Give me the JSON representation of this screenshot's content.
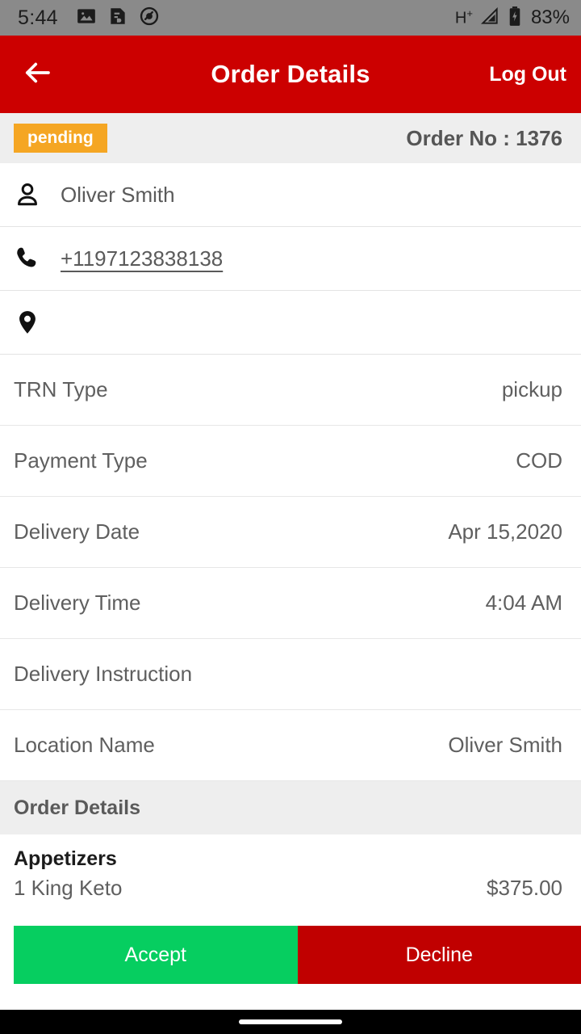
{
  "status_bar": {
    "time": "5:44",
    "left_icons": [
      "image-icon",
      "file-document-icon",
      "do-not-disturb-icon"
    ],
    "network_type": "H",
    "network_sup": "+",
    "signal_icon": "signal-triangle-icon",
    "battery_icon": "battery-charging-icon",
    "battery_percent": "83%"
  },
  "app_bar": {
    "back_icon": "arrow-left-icon",
    "title": "Order Details",
    "logout_label": "Log Out"
  },
  "order_strip": {
    "status_badge": "pending",
    "order_no": "Order No : 1376"
  },
  "contact": {
    "customer_icon": "person-icon",
    "customer_name": "Oliver Smith",
    "phone_icon": "phone-icon",
    "phone_number": "+1197123838138 ",
    "location_icon": "map-pin-icon",
    "address": ""
  },
  "info_rows": [
    {
      "label": "TRN Type",
      "value": "pickup"
    },
    {
      "label": "Payment Type",
      "value": "COD"
    },
    {
      "label": "Delivery Date",
      "value": "Apr 15,2020"
    },
    {
      "label": "Delivery Time",
      "value": "4:04 AM"
    },
    {
      "label": "Delivery Instruction",
      "value": ""
    },
    {
      "label": "Location Name",
      "value": "Oliver Smith"
    }
  ],
  "order_details": {
    "section_title": "Order Details",
    "category": "Appetizers",
    "item_name": "1 King Keto",
    "item_price": "$375.00"
  },
  "actions": {
    "accept_label": "Accept",
    "decline_label": "Decline",
    "accept_color": "#06ce60",
    "decline_color": "#c00000"
  },
  "theme": {
    "primary": "#cc0000",
    "badge": "#f5a623",
    "strip_bg": "#eeeeee"
  }
}
